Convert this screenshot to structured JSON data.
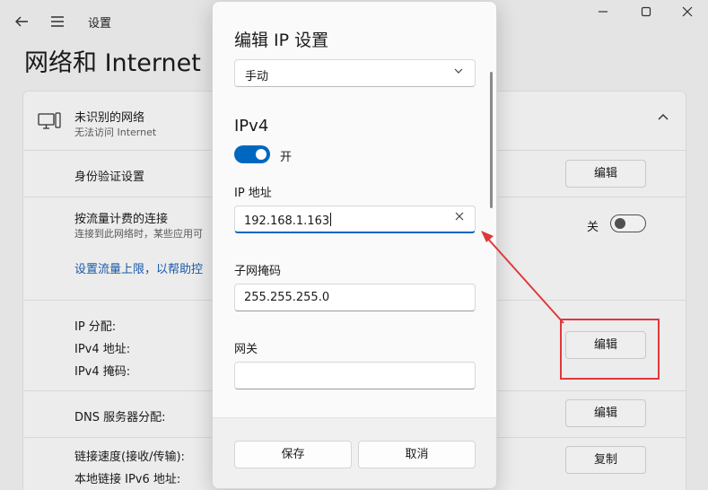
{
  "window": {
    "breadcrumb": "设置",
    "page_title": "网络和 Internet",
    "back_icon": "back-arrow-icon",
    "menu_icon": "hamburger-icon",
    "controls": [
      "minimize-icon",
      "maximize-icon",
      "close-icon"
    ]
  },
  "network": {
    "name": "未识别的网络",
    "status": "无法访问 Internet"
  },
  "rows": {
    "auth_label": "身份验证设置",
    "auth_button": "编辑",
    "metered_label": "按流量计费的连接",
    "metered_sub": "连接到此网络时，某些应用可",
    "metered_toggle_text": "关",
    "data_limit_link": "设置流量上限，以帮助控",
    "ip_assign_label": "IP 分配:",
    "ipv4_addr_label": "IPv4 地址:",
    "ipv4_mask_label": "IPv4 掩码:",
    "ip_button": "编辑",
    "dns_label": "DNS 服务器分配:",
    "dns_button": "编辑",
    "link_speed_label": "链接速度(接收/传输):",
    "ipv6_label": "本地链接 IPv6 地址:",
    "copy_button": "复制"
  },
  "dialog": {
    "title": "编辑 IP 设置",
    "mode_value": "手动",
    "section": "IPv4",
    "toggle_text": "开",
    "ip_label": "IP 地址",
    "ip_value": "192.168.1.163",
    "mask_label": "子网掩码",
    "mask_value": "255.255.255.0",
    "gateway_label": "网关",
    "gateway_value": "",
    "save_label": "保存",
    "cancel_label": "取消"
  },
  "colors": {
    "accent": "#0067c0",
    "annotation": "#e0383b"
  }
}
